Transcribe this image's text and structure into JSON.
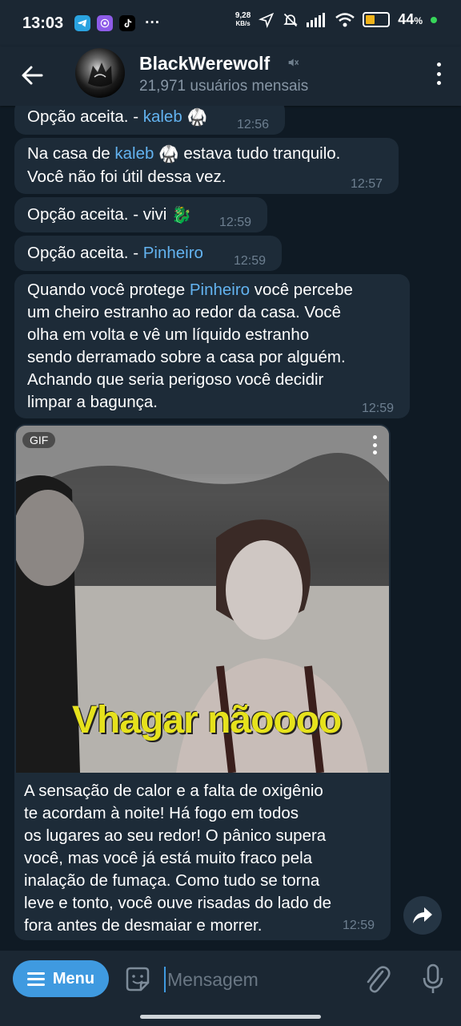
{
  "status_bar": {
    "time": "13:03",
    "net_speed_value": "9,28",
    "net_speed_unit": "KB/s",
    "battery_percent": "44",
    "battery_suffix": "%",
    "battery_level": 0.44,
    "more_label": "···",
    "colors": {
      "battery": "#f0b31a",
      "dot": "#37d65a"
    }
  },
  "header": {
    "title": "BlackWerewolf",
    "subtitle": "21,971 usuários mensais",
    "mute_icon": "muted-speaker-icon"
  },
  "messages": [
    {
      "prefix": "Opção aceita. - ",
      "link": "kaleb",
      "emoji": "🥋",
      "time": "12:56"
    },
    {
      "line1_prefix": "Na casa de ",
      "link": "kaleb",
      "emoji": "🥋",
      "line1_suffix": " estava tudo tranquilo.",
      "line2": "Você não foi útil dessa vez.",
      "time": "12:57"
    },
    {
      "prefix": "Opção aceita. - vivi ",
      "emoji": "🐉",
      "time": "12:59"
    },
    {
      "prefix": "Opção aceita. - ",
      "link": "Pinheiro",
      "time": "12:59"
    },
    {
      "line1_prefix": "Quando você protege ",
      "link": "Pinheiro",
      "line1_suffix": " você percebe",
      "lines": [
        "um cheiro estranho ao redor da casa. Você",
        "olha em volta e vê um líquido estranho",
        "sendo derramado sobre a casa por alguém.",
        "Achando que seria perigoso você decidir",
        "limpar a bagunça."
      ],
      "time": "12:59"
    }
  ],
  "gif_message": {
    "badge": "GIF",
    "caption_overlay": "Vhagar nãoooo",
    "lines": [
      "A sensação de calor e a falta de oxigênio",
      "te acordam à noite! Há fogo em todos",
      "os lugares ao seu redor! O pânico supera",
      "você, mas você já está muito fraco pela",
      "inalação de fumaça. Como tudo se torna",
      "leve e tonto, você ouve risadas do lado de",
      "fora antes de desmaiar e morrer."
    ],
    "time": "12:59"
  },
  "input_bar": {
    "menu_label": "Menu",
    "placeholder": "Mensagem"
  },
  "colors": {
    "link": "#63b3f0",
    "bubble": "#1d2b38",
    "background": "#0f1a24",
    "header": "#1b2733",
    "accent": "#3f9ae0"
  }
}
